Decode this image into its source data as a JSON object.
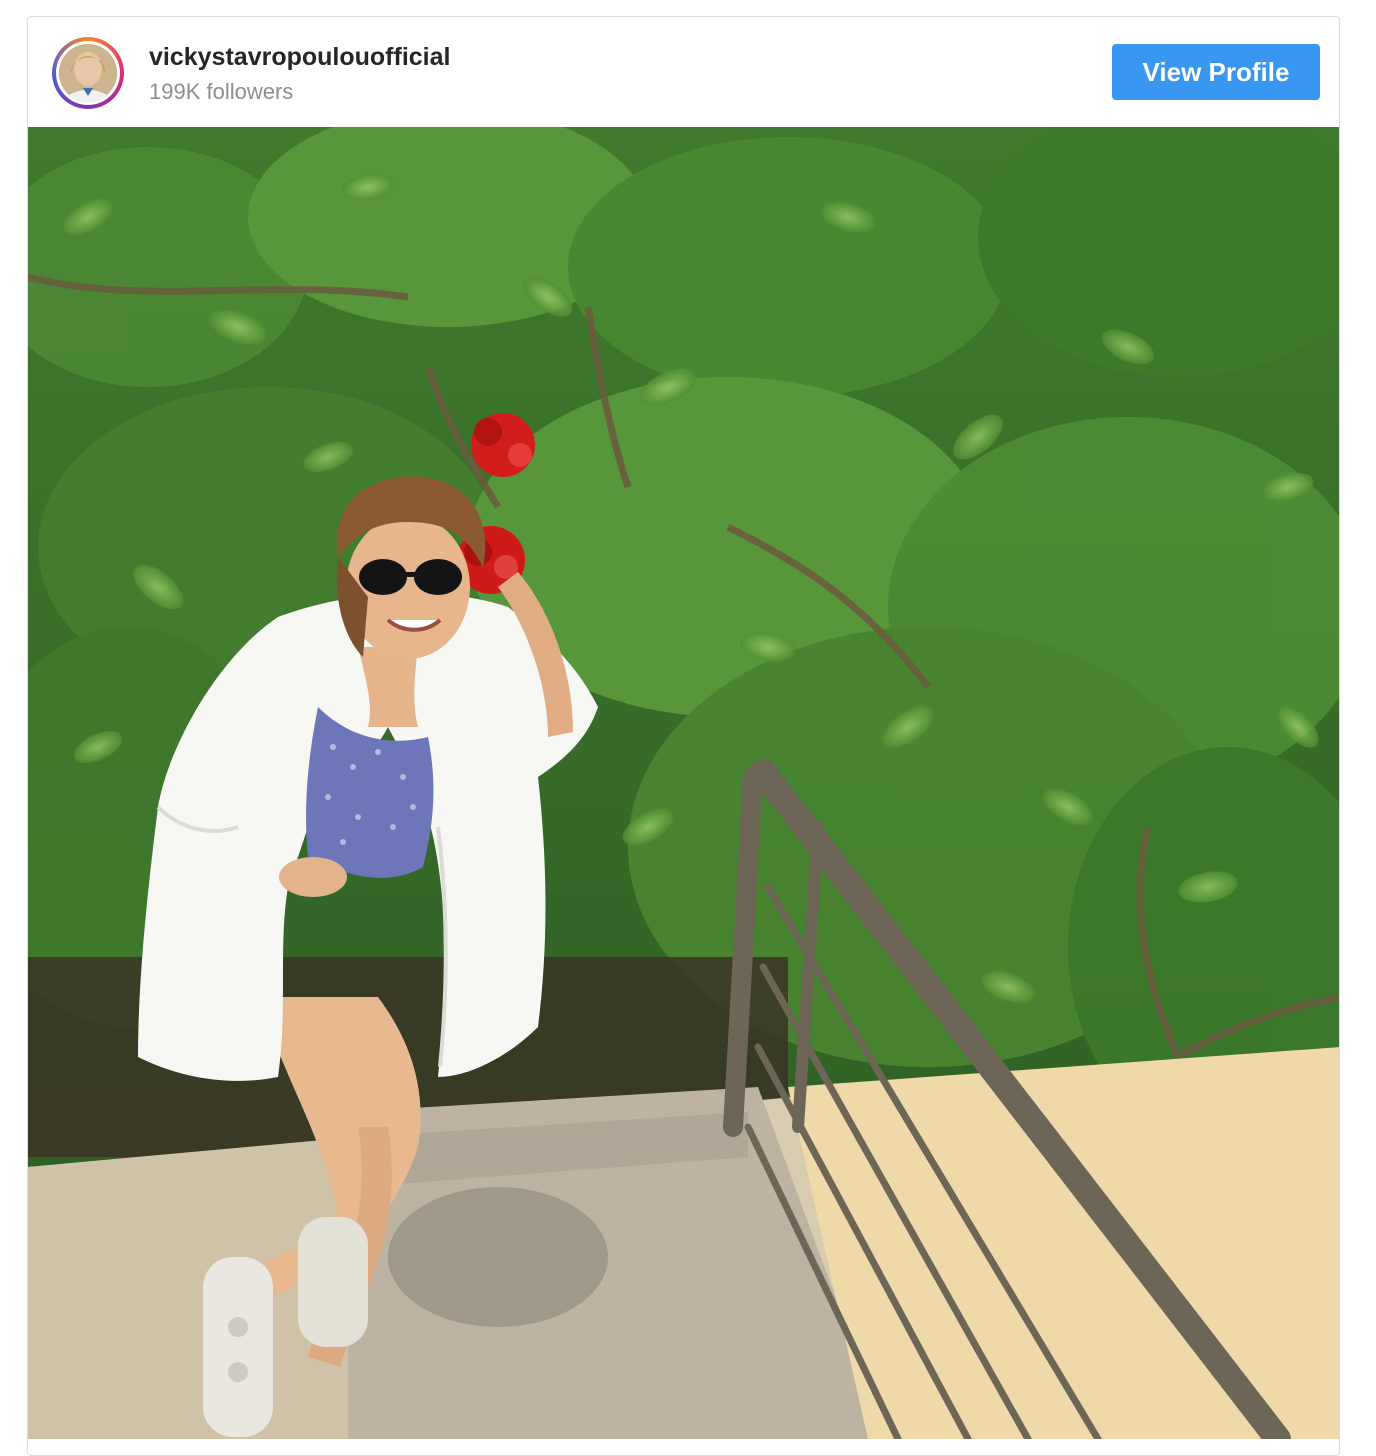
{
  "post": {
    "username": "vickystavropoulouofficial",
    "followers": "199K followers",
    "view_profile_label": "View Profile",
    "avatar_icon": "profile-avatar",
    "photo_icon": "post-photo",
    "colors": {
      "button": "#3897f0",
      "username": "#262626",
      "followers": "#8e8e8e",
      "border": "#dbdbdb"
    }
  }
}
